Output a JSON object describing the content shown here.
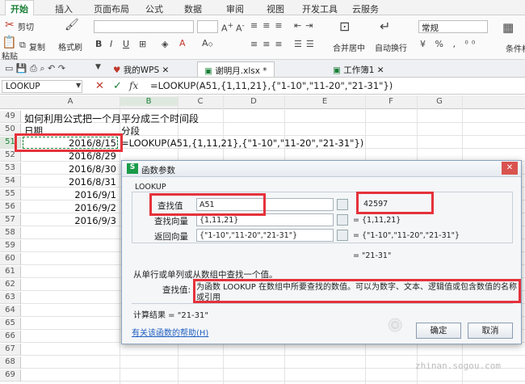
{
  "ribbon": {
    "tabs": [
      "开始",
      "插入",
      "页面布局",
      "公式",
      "数据",
      "审阅",
      "视图",
      "开发工具",
      "云服务"
    ],
    "cut": "剪切",
    "paste": "粘贴",
    "copy": "复制",
    "format_painter": "格式刷",
    "merge_center": "合并居中",
    "wrap_text": "自动换行",
    "number_format": "常规",
    "conditional": "条件格"
  },
  "doc_tabs": {
    "home": "我的WPS",
    "file": "谢明月.xlsx *",
    "workbook": "工作簿1"
  },
  "formula_bar": {
    "name_box": "LOOKUP",
    "fx": "fx",
    "formula": "=LOOKUP(A51,{1,11,21},{\"1-10\",\"11-20\",\"21-31\"})"
  },
  "grid": {
    "columns": [
      "A",
      "B",
      "C",
      "D",
      "E",
      "F",
      "G"
    ],
    "row49_title": "如何利用公式把一个月平分成三个时间段",
    "row50": {
      "a": "日期",
      "b": "分段"
    },
    "row51": {
      "a": "2016/8/15",
      "b": "=LOOKUP(A51,{1,11,21},{\"1-10\",\"11-20\",\"21-31\"})"
    },
    "rows": [
      {
        "num": "49"
      },
      {
        "num": "50"
      },
      {
        "num": "51"
      },
      {
        "num": "52",
        "a": "2016/8/29"
      },
      {
        "num": "53",
        "a": "2016/8/30"
      },
      {
        "num": "54",
        "a": "2016/8/31"
      },
      {
        "num": "55",
        "a": "2016/9/1"
      },
      {
        "num": "56",
        "a": "2016/9/2"
      },
      {
        "num": "57",
        "a": "2016/9/3"
      },
      {
        "num": "58"
      },
      {
        "num": "59"
      },
      {
        "num": "60"
      },
      {
        "num": "61"
      },
      {
        "num": "62"
      },
      {
        "num": "63"
      },
      {
        "num": "64"
      },
      {
        "num": "65"
      },
      {
        "num": "66"
      },
      {
        "num": "67"
      },
      {
        "num": "68"
      },
      {
        "num": "69"
      }
    ]
  },
  "dialog": {
    "title": "函数参数",
    "function_name": "LOOKUP",
    "fields": [
      {
        "label": "查找值",
        "value": "A51",
        "result": "42597"
      },
      {
        "label": "查找向量",
        "value": "{1,11,21}",
        "result": "= {1,11,21}"
      },
      {
        "label": "返回向量",
        "value": "{\"1-10\",\"11-20\",\"21-31\"}",
        "result": "= {\"1-10\",\"11-20\",\"21-31\"}"
      }
    ],
    "overall_result": "= \"21-31\"",
    "description": "从单行或单列或从数组中查找一个值。",
    "param_label": "查找值:",
    "param_desc": "为函数 LOOKUP 在数组中所要查找的数值。可以为数字、文本、逻辑值或包含数值的名称或引用",
    "calc_result": "计算结果 = \"21-31\"",
    "help_link": "有关该函数的帮助(H)",
    "ok": "确定",
    "cancel": "取消"
  },
  "watermark": "zhinan.sogou.com"
}
